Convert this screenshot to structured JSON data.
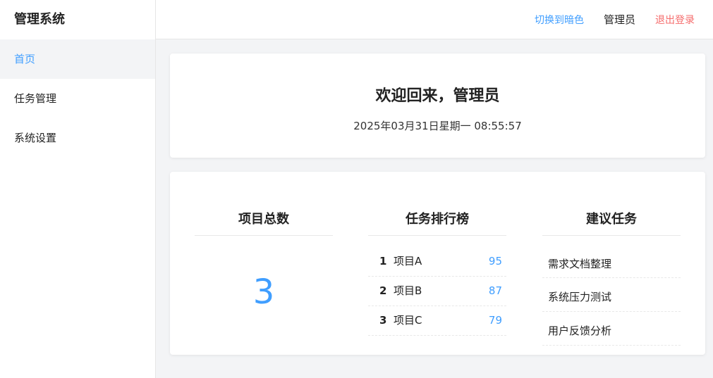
{
  "sidebar": {
    "brand": "管理系统",
    "items": [
      {
        "label": "首页",
        "active": true
      },
      {
        "label": "任务管理",
        "active": false
      },
      {
        "label": "系统设置",
        "active": false
      }
    ]
  },
  "header": {
    "theme_toggle": "切换到暗色",
    "user_name": "管理员",
    "logout": "退出登录"
  },
  "welcome": {
    "title": "欢迎回来，管理员",
    "datetime": "2025年03月31日星期一 08:55:57"
  },
  "stats": {
    "total": {
      "title": "项目总数",
      "value": "3"
    },
    "ranking": {
      "title": "任务排行榜",
      "rows": [
        {
          "rank": "1",
          "name": "项目A",
          "score": "95"
        },
        {
          "rank": "2",
          "name": "项目B",
          "score": "87"
        },
        {
          "rank": "3",
          "name": "项目C",
          "score": "79"
        }
      ]
    },
    "suggested": {
      "title": "建议任务",
      "items": [
        "需求文档整理",
        "系统压力测试",
        "用户反馈分析"
      ]
    }
  },
  "colors": {
    "accent": "#409eff",
    "danger": "#f56c6c",
    "background": "#f3f4f6"
  }
}
